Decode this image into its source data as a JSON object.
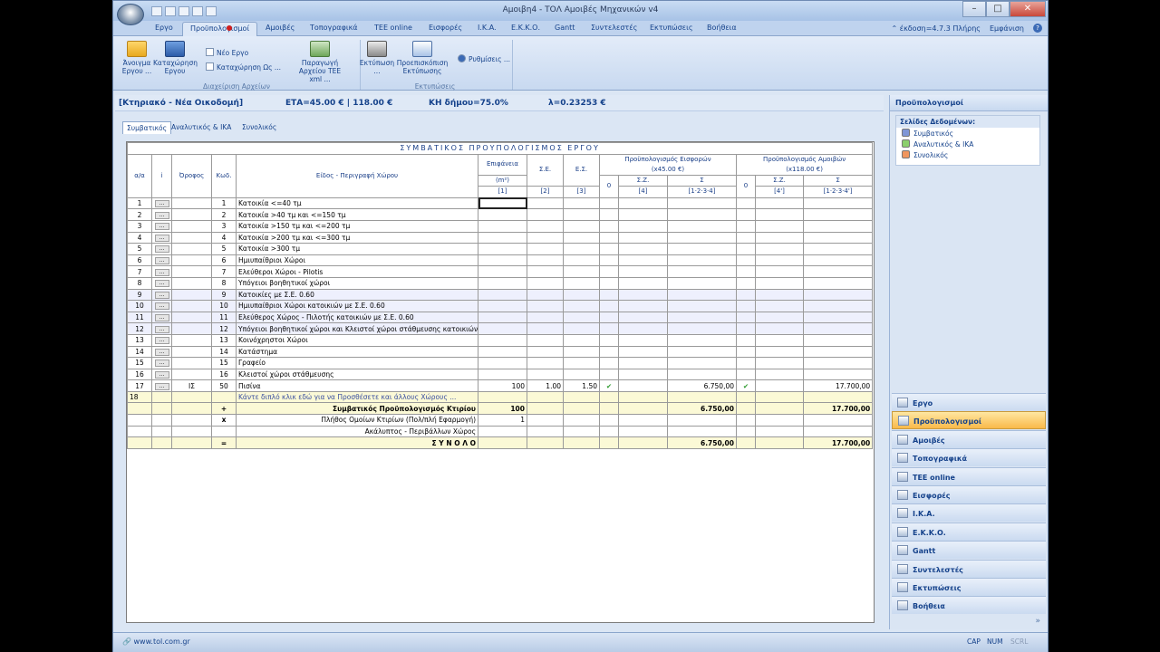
{
  "window": {
    "title": "Αμοιβη4 - ΤΟΛ Αμοιβές Μηχανικών v4",
    "min": "–",
    "max": "□",
    "close": "✕"
  },
  "ribbon_tabs": [
    "Εργο",
    "Προϋπολογισμοί",
    "Αμοιβές",
    "Τοπογραφικά",
    "TEE online",
    "Εισφορές",
    "I.K.A.",
    "Ε.Κ.Κ.Ο.",
    "Gantt",
    "Συντελεστές",
    "Εκτυπώσεις",
    "Βοήθεια"
  ],
  "active_tab": "Προϋπολογισμοί",
  "tab_right": {
    "version": "έκδοση=4.7.3 Πλήρης",
    "view": "Εμφάνιση"
  },
  "ribbon": {
    "open_label": "Άνοιγμα Εργου ...",
    "save_label": "Καταχώρηση Εργου",
    "new_label": "Νέο Εργο",
    "saveas_label": "Καταχώρηση Ως ...",
    "xml_label": "Παραγωγή Αρχείου ΤΕΕ xml ...",
    "group1": "Διαχείριση Αρχείων",
    "print_label": "Εκτύπωση ...",
    "preview_label": "Προεπισκόπιση Εκτύπωσης",
    "group2": "Εκτυπώσεις",
    "settings_label": "Ρυθμίσεις ..."
  },
  "info": {
    "project": "[Κτηριακό - Νέα Οικοδομή]",
    "eta": "ΕΤΑ=45.00 € | 118.00 €",
    "kh": "ΚΗ δήμου=75.0%",
    "lambda": "λ=0.23253 €"
  },
  "subtabs": [
    "Συμβατικός",
    "Αναλυτικός & ΙΚΑ",
    "Συνολικός"
  ],
  "grid": {
    "title": "ΣΥΜΒΑΤΙΚΟΣ ΠΡΟΥΠΟΛΟΓΙΣΜΟΣ ΕΡΓΟΥ",
    "h_aa": "α/α",
    "h_i": "i",
    "h_floor": "Όροφος",
    "h_code": "Κωδ.",
    "h_desc": "Είδος - Περιγραφή Χώρου",
    "h_area": "Επιφάνεια",
    "h_area_unit": "(m²)",
    "h_area_ref": "[1]",
    "h_se": "Σ.Ε.",
    "h_se_ref": "[2]",
    "h_es": "Ε.Σ.",
    "h_es_ref": "[3]",
    "h_contrib": "Προϋπολογισμός Εισφορών",
    "h_contrib_sub": "(x45.00 €)",
    "h_fees": "Προϋπολογισμός Αμοιβών",
    "h_fees_sub": "(x118.00 €)",
    "h_zero": "0",
    "h_sz": "Σ.Ζ.",
    "h_sz_ref": "[4]",
    "h_sigma": "Σ",
    "h_sigma_ref": "[1·2·3·4]",
    "h_sz2_ref": "[4']",
    "h_sigma2_ref": "[1·2·3·4']",
    "rows": [
      {
        "n": "1",
        "code": "1",
        "desc": "Κατοικία <=40 τμ"
      },
      {
        "n": "2",
        "code": "2",
        "desc": "Κατοικία >40 τμ και <=150 τμ"
      },
      {
        "n": "3",
        "code": "3",
        "desc": "Κατοικία >150 τμ και <=200 τμ"
      },
      {
        "n": "4",
        "code": "4",
        "desc": "Κατοικία >200 τμ και <=300 τμ"
      },
      {
        "n": "5",
        "code": "5",
        "desc": "Κατοικία >300 τμ"
      },
      {
        "n": "6",
        "code": "6",
        "desc": "Ημιυπαίθριοι Χώροι"
      },
      {
        "n": "7",
        "code": "7",
        "desc": "Ελεύθεροι Χώροι - Pilotis"
      },
      {
        "n": "8",
        "code": "8",
        "desc": "Υπόγειοι βοηθητικοί χώροι"
      },
      {
        "n": "9",
        "code": "9",
        "desc": "Κατοικίες με Σ.Ε. 0.60"
      },
      {
        "n": "10",
        "code": "10",
        "desc": "Ημιυπαίθριοι Χώροι κατοικιών με Σ.Ε. 0.60"
      },
      {
        "n": "11",
        "code": "11",
        "desc": "Ελεύθερος Χώρος - Πιλοτής κατοικιών με Σ.Ε. 0.60"
      },
      {
        "n": "12",
        "code": "12",
        "desc": "Υπόγειοι βοηθητικοί χώροι και Κλειστοί χώροι στάθμευσης κατοικιών με Σ"
      },
      {
        "n": "13",
        "code": "13",
        "desc": "Κοινόχρηστοι Χώροι"
      },
      {
        "n": "14",
        "code": "14",
        "desc": "Κατάστημα"
      },
      {
        "n": "15",
        "code": "15",
        "desc": "Γραφείο"
      },
      {
        "n": "16",
        "code": "16",
        "desc": "Κλειστοί χώροι στάθμευσης"
      },
      {
        "n": "17",
        "floor": "ΙΣ",
        "code": "50",
        "desc": "Πισίνα",
        "area": "100",
        "se": "1.00",
        "es": "1.50",
        "c_sigma": "6.750,00",
        "f_sigma": "17.700,00"
      }
    ],
    "row18_n": "18",
    "row18_hint": "Κάντε διπλό κλικ εδώ για να Προσθέσετε και άλλους Χώρους ...",
    "sum_sign": "+",
    "sum_label": "Συμβατικός Προϋπολογισμός Κτιρίου",
    "sum_area": "100",
    "sum_c": "6.750,00",
    "sum_f": "17.700,00",
    "mult_sign": "x",
    "mult_label": "Πλήθος Ομοίων Κτιρίων (Πολ/πλή Εφαρμογή)",
    "mult_val": "1",
    "uncov_label": "Ακάλυπτος - Περιβάλλων Χώρος",
    "total_sign": "=",
    "total_label": "Σ Υ Ν Ο Λ Ο",
    "total_c": "6.750,00",
    "total_f": "17.700,00",
    "check": "✔"
  },
  "right_panel": {
    "title": "Προϋπολογισμοί",
    "pages_head": "Σελίδες Δεδομένων:",
    "pages": [
      {
        "label": "Συμβατικός",
        "color": "#7f96d6"
      },
      {
        "label": "Αναλυτικός & ΙΚΑ",
        "color": "#8bcf6c"
      },
      {
        "label": "Συνολικός",
        "color": "#f0965e"
      }
    ],
    "nav": [
      "Εργο",
      "Προϋπολογισμοί",
      "Αμοιβές",
      "Τοπογραφικά",
      "TEE online",
      "Εισφορές",
      "I.K.A.",
      "Ε.Κ.Κ.Ο.",
      "Gantt",
      "Συντελεστές",
      "Εκτυπώσεις",
      "Βοήθεια"
    ],
    "nav_active": "Προϋπολογισμοί",
    "more": "»"
  },
  "status": {
    "url": "www.tol.com.gr",
    "cap": "CAP",
    "num": "NUM",
    "scrl": "SCRL"
  }
}
